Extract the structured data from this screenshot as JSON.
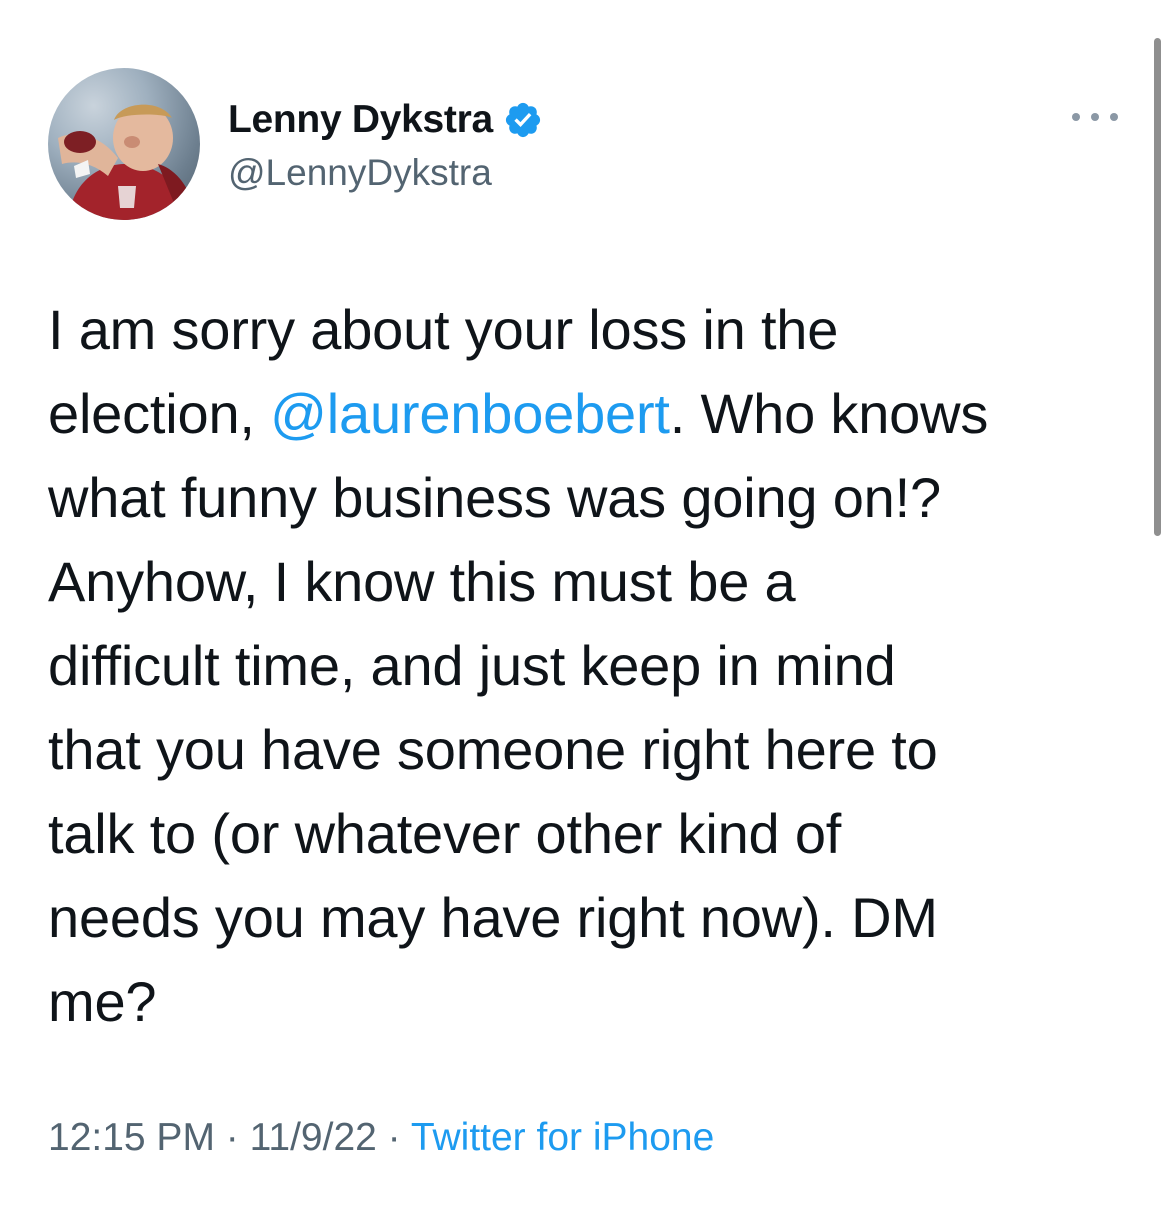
{
  "author": {
    "display_name": "Lenny Dykstra",
    "handle": "@LennyDykstra",
    "verified": true,
    "avatar_icon": "profile-photo-baseball-player",
    "verified_icon": "verified-badge-icon"
  },
  "more_icon": "more-options-icon",
  "tweet": {
    "lines": [
      {
        "pre": "I am sorry about your loss in the",
        "mention": "",
        "post": ""
      },
      {
        "pre": "election, ",
        "mention": "@laurenboebert",
        "post": ". Who knows"
      },
      {
        "pre": "what funny business was going on!?",
        "mention": "",
        "post": ""
      },
      {
        "pre": "Anyhow, I know this must be a",
        "mention": "",
        "post": ""
      },
      {
        "pre": "difficult time, and just keep in mind",
        "mention": "",
        "post": ""
      },
      {
        "pre": "that you have someone right here to",
        "mention": "",
        "post": ""
      },
      {
        "pre": "talk to (or whatever other kind of",
        "mention": "",
        "post": ""
      },
      {
        "pre": "needs you may have right now). DM",
        "mention": "",
        "post": ""
      },
      {
        "pre": "me?",
        "mention": "",
        "post": ""
      }
    ]
  },
  "meta": {
    "time": "12:15 PM",
    "sep1": " · ",
    "date": "11/9/22",
    "sep2": " · ",
    "source": "Twitter for iPhone"
  },
  "colors": {
    "text": "#0f1419",
    "secondary": "#536471",
    "link": "#1d9bf0",
    "verified": "#1d9bf0"
  }
}
